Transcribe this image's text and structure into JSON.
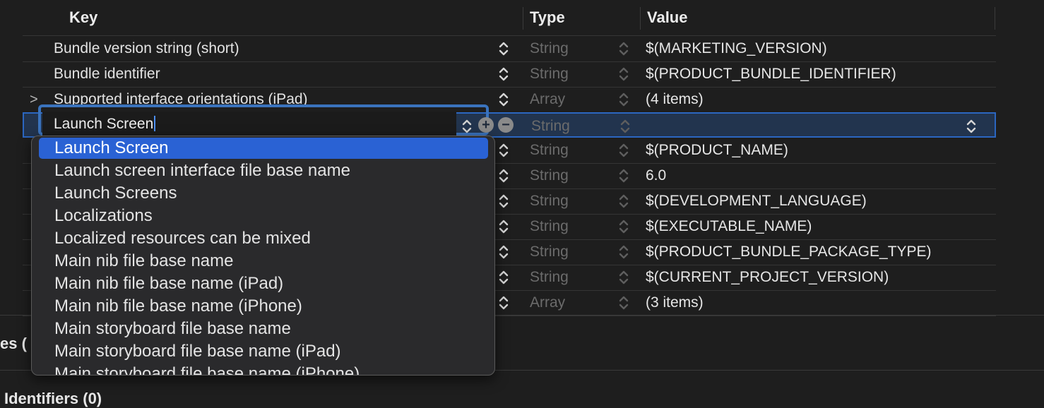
{
  "columns": {
    "key": "Key",
    "type": "Type",
    "value": "Value"
  },
  "rows": [
    {
      "key": "Bundle version string (short)",
      "type": "String",
      "value": "$(MARKETING_VERSION)",
      "disclosure": ""
    },
    {
      "key": "Bundle identifier",
      "type": "String",
      "value": "$(PRODUCT_BUNDLE_IDENTIFIER)",
      "disclosure": ""
    },
    {
      "key": "Supported interface orientations (iPad)",
      "type": "Array",
      "value": "(4 items)",
      "disclosure": ">"
    },
    {
      "key": "",
      "type": "String",
      "value": "",
      "disclosure": ""
    },
    {
      "key": "",
      "type": "String",
      "value": "$(PRODUCT_NAME)",
      "disclosure": ""
    },
    {
      "key": "",
      "type": "String",
      "value": "6.0",
      "disclosure": ""
    },
    {
      "key": "",
      "type": "String",
      "value": "$(DEVELOPMENT_LANGUAGE)",
      "disclosure": ""
    },
    {
      "key": "",
      "type": "String",
      "value": "$(EXECUTABLE_NAME)",
      "disclosure": ""
    },
    {
      "key": "",
      "type": "String",
      "value": "$(PRODUCT_BUNDLE_PACKAGE_TYPE)",
      "disclosure": ""
    },
    {
      "key": "",
      "type": "String",
      "value": "$(CURRENT_PROJECT_VERSION)",
      "disclosure": ""
    },
    {
      "key": "",
      "type": "Array",
      "value": "(3 items)",
      "disclosure": ""
    }
  ],
  "editor": {
    "value": "Launch Screen",
    "add_symbol": "+",
    "remove_symbol": "−"
  },
  "dropdown": {
    "options": [
      "Launch Screen",
      "Launch screen interface file base name",
      "Launch Screens",
      "Localizations",
      "Localized resources can be mixed",
      "Main nib file base name",
      "Main nib file base name (iPad)",
      "Main nib file base name (iPhone)",
      "Main storyboard file base name",
      "Main storyboard file base name (iPad)",
      "Main storyboard file base name (iPhone)"
    ],
    "selected_index": 0
  },
  "sections": {
    "partial_label": "es (",
    "identifiers": "Identifiers (0)"
  },
  "colors": {
    "background": "#1e1e1e",
    "selection": "#2a62d4",
    "focus_ring": "#3a73bd"
  }
}
